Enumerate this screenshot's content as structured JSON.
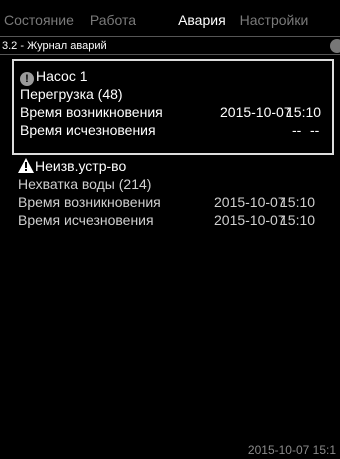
{
  "tabs": [
    {
      "label": "Состояние",
      "active": false
    },
    {
      "label": "Работа",
      "active": false
    },
    {
      "label": "Авария",
      "active": true
    },
    {
      "label": "Настройки",
      "active": false
    }
  ],
  "breadcrumb": "3.2 - Журнал аварий",
  "alarms": [
    {
      "icon": "exclamation-icon",
      "source": "Насос 1",
      "message": "Перегрузка (48)",
      "occurred_label": "Время возникновения",
      "occurred_date": "2015-10-07",
      "occurred_time": "15:10",
      "cleared_label": "Время исчезновения",
      "cleared_date": "--",
      "cleared_time": "--"
    },
    {
      "icon": "warning-icon",
      "source": "Неизв.устр-во",
      "message": "Нехватка воды (214)",
      "occurred_label": "Время возникновения",
      "occurred_date": "2015-10-07",
      "occurred_time": "15:10",
      "cleared_label": "Время исчезновения",
      "cleared_date": "2015-10-07",
      "cleared_time": "15:10"
    }
  ],
  "footer_datetime": "2015-10-07  15:1",
  "colors": {
    "background": "#000000",
    "text": "#ffffff",
    "inactive_tab": "#7a7a7a"
  }
}
